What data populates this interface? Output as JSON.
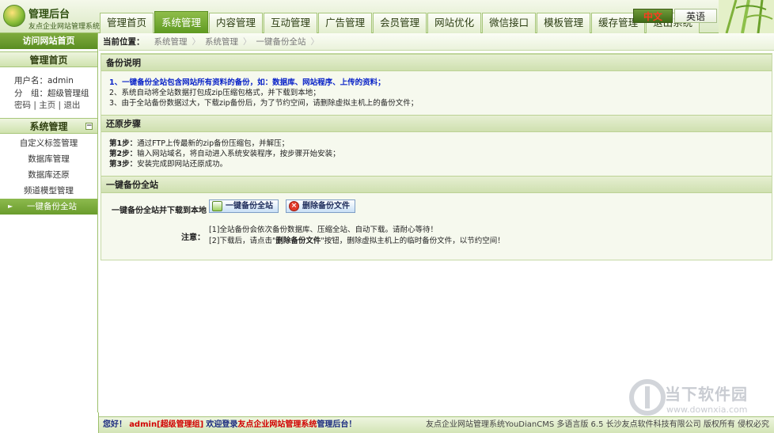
{
  "header": {
    "logo_title": "管理后台",
    "logo_subtitle": "友点企业网站管理系统",
    "nav": [
      "管理首页",
      "系统管理",
      "内容管理",
      "互动管理",
      "广告管理",
      "会员管理",
      "网站优化",
      "微信接口",
      "模板管理",
      "缓存管理",
      "退出系统"
    ],
    "active_nav": "系统管理",
    "lang_cn": "中文",
    "lang_en": "英语"
  },
  "sidebar": {
    "visit_site": "访问网站首页",
    "home_head": "管理首页",
    "username_line": "用户名：admin",
    "group_line": "分　组：超级管理组",
    "links": [
      "密码",
      "主页",
      "退出"
    ],
    "system_head": "系统管理",
    "collapse_symbol": "−",
    "menu": [
      "自定义标签管理",
      "数据库管理",
      "数据库还原",
      "频道模型管理",
      "一键备份全站"
    ],
    "active_menu": "一键备份全站"
  },
  "breadcrumb": {
    "label": "当前位置：",
    "items": [
      "系统管理",
      "系统管理",
      "一键备份全站"
    ]
  },
  "main": {
    "backup_desc": {
      "title": "备份说明",
      "line1": "1、一键备份全站包含网站所有资料的备份，如：数据库、网站程序、上传的资料；",
      "line2": "2、系统自动将全站数据打包成zip压缩包格式，并下载到本地；",
      "line3": "3、由于全站备份数据过大，下载zip备份后，为了节约空间，请删除虚拟主机上的备份文件；"
    },
    "restore": {
      "title": "还原步骤",
      "step1_label": "第1步：",
      "step1": "通过FTP上传最新的zip备份压缩包，并解压；",
      "step2_label": "第2步：",
      "step2": "输入网站域名，将自动进入系统安装程序，按步骤开始安装；",
      "step3_label": "第3步：",
      "step3": "安装完成即网站还原成功。"
    },
    "backup": {
      "title": "一键备份全站",
      "row_label": "一键备份全站并下载到本地",
      "backup_button": "一键备份全站",
      "delete_button": "删除备份文件",
      "note_label": "注意：",
      "note1": "[1]全站备份会依次备份数据库、压缩全站、自动下载。请耐心等待！",
      "note2_prefix": "[2]下载后，请点击\"",
      "note2_highlight": "删除备份文件",
      "note2_suffix": "\"按钮，删除虚拟主机上的临时备份文件，以节约空间！"
    }
  },
  "footer": {
    "hello": "您好！",
    "user": "admin[超级管理组]",
    "welcome": "欢迎登录",
    "site": "友点企业网站管理系统",
    "site_suffix": "管理后台！",
    "right_text": "友点企业网站管理系统YouDianCMS 多语言版 6.5 长沙友点软件科技有限公司 版权所有 侵权必究"
  },
  "watermark": {
    "brand": "当下软件园",
    "url": "www.downxia.com"
  }
}
